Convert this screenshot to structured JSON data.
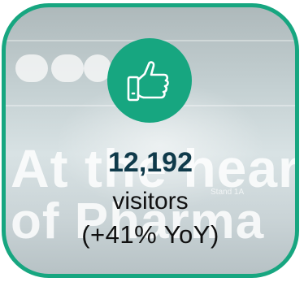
{
  "card": {
    "background_text_line1": "At the heart",
    "background_text_line2": "of Pharma",
    "background_small_text": "Stand 1A",
    "icon": "thumbs-up-icon",
    "value": "12,192",
    "label": "visitors",
    "change": "(+41% YoY)"
  },
  "colors": {
    "accent": "#17a680",
    "value_text": "#0f3a4a",
    "label_text": "#111111"
  }
}
